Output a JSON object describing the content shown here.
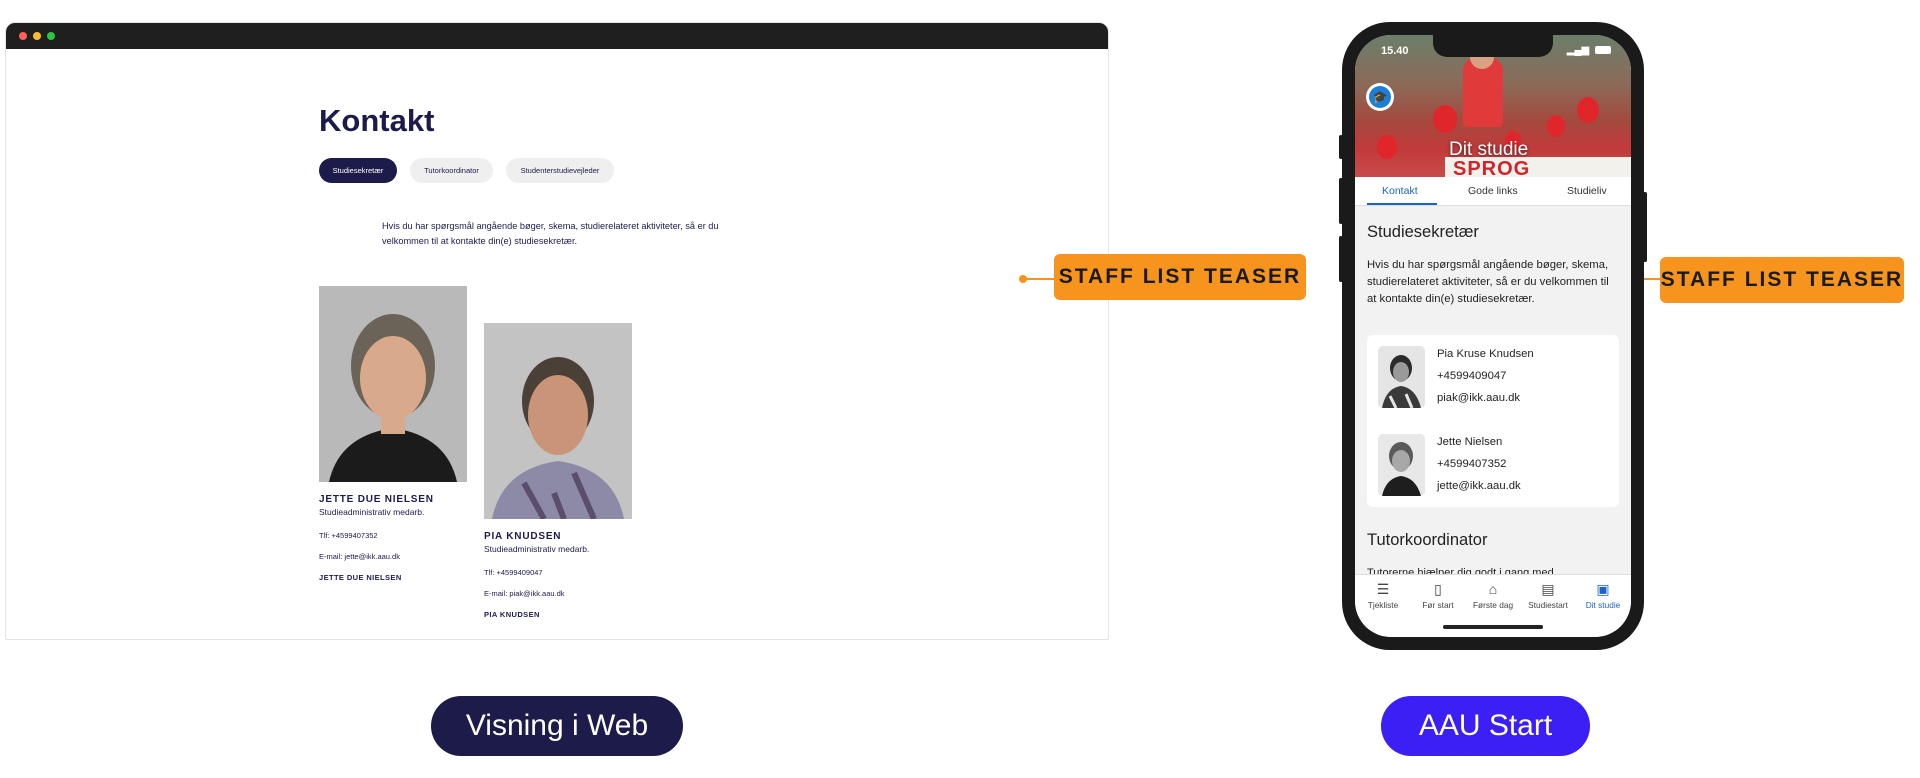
{
  "web": {
    "title": "Kontakt",
    "tabs": [
      "Studiesekretær",
      "Tutorkoordinator",
      "Studenterstudievejleder"
    ],
    "intro": "Hvis du har spørgsmål angående bøger, skema, studierelateret aktiviteter, så er du velkommen til at kontakte din(e) studiesekretær.",
    "people": [
      {
        "name": "JETTE DUE NIELSEN",
        "role": "Studieadministrativ medarb.",
        "tel": "Tlf: +4599407352",
        "email": "E-mail: jette@ikk.aau.dk",
        "link": "JETTE DUE NIELSEN"
      },
      {
        "name": "PIA KNUDSEN",
        "role": "Studieadministrativ medarb.",
        "tel": "Tlf: +4599409047",
        "email": "E-mail: piak@ikk.aau.dk",
        "link": "PIA KNUDSEN"
      }
    ]
  },
  "callouts": {
    "web": "STAFF LIST TEASER",
    "app": "STAFF LIST TEASER"
  },
  "labels": {
    "web": "Visning i Web",
    "app": "AAU Start"
  },
  "app": {
    "status_time": "15.40",
    "hero_title": "Dit studie",
    "hero_sign": "SPROG",
    "tabs": [
      "Kontakt",
      "Gode links",
      "Studieliv"
    ],
    "section1_title": "Studiesekretær",
    "section1_text": "Hvis du har spørgsmål angående bøger, skema, studierelateret aktiviteter, så er du velkommen til at kontakte din(e) studiesekretær.",
    "contacts": [
      {
        "name": "Pia Kruse Knudsen",
        "phone": "+4599409047",
        "email": "piak@ikk.aau.dk"
      },
      {
        "name": "Jette Nielsen",
        "phone": "+4599407352",
        "email": "jette@ikk.aau.dk"
      }
    ],
    "section2_title": "Tutorkoordinator",
    "section2_text": "Tutorerne hjælper dig godt i gang med",
    "nav": [
      {
        "label": "Tjekliste",
        "icon": "checklist-icon"
      },
      {
        "label": "Før start",
        "icon": "book-icon"
      },
      {
        "label": "Første dag",
        "icon": "school-icon"
      },
      {
        "label": "Studiestart",
        "icon": "calendar-icon"
      },
      {
        "label": "Dit studie",
        "icon": "contact-card-icon"
      }
    ],
    "active_nav": "Dit studie"
  },
  "colors": {
    "navy": "#1d1b4a",
    "orange": "#f7941d",
    "app_blue": "#1c63c8",
    "violet": "#3b1ff5"
  }
}
